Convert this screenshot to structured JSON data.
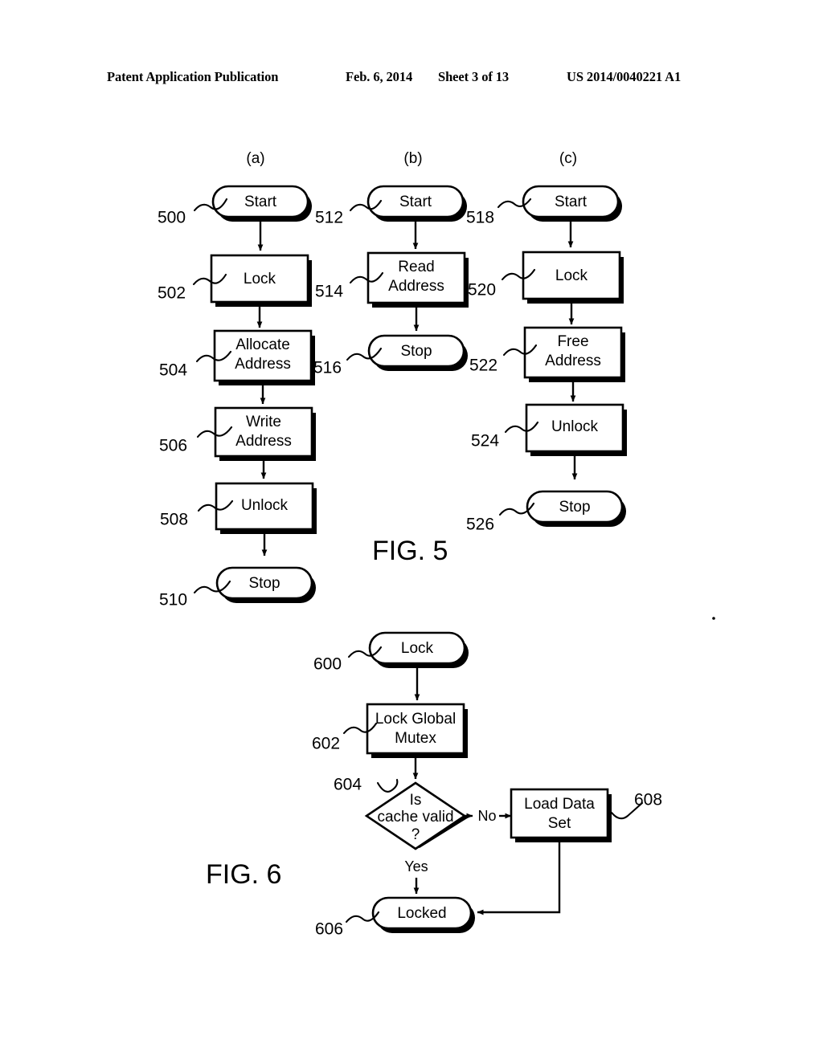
{
  "header": {
    "publication": "Patent Application Publication",
    "date": "Feb. 6, 2014",
    "sheet": "Sheet 3 of 13",
    "number": "US 2014/0040221 A1"
  },
  "figures": [
    {
      "label": "FIG. 5",
      "columns": [
        {
          "caption": "(a)",
          "nodes": [
            {
              "ref": "500",
              "text": "Start",
              "shape": "pill"
            },
            {
              "ref": "502",
              "text": "Lock",
              "shape": "box"
            },
            {
              "ref": "504",
              "text": "Allocate Address",
              "shape": "box"
            },
            {
              "ref": "506",
              "text": "Write Address",
              "shape": "box"
            },
            {
              "ref": "508",
              "text": "Unlock",
              "shape": "box"
            },
            {
              "ref": "510",
              "text": "Stop",
              "shape": "pill"
            }
          ]
        },
        {
          "caption": "(b)",
          "nodes": [
            {
              "ref": "512",
              "text": "Start",
              "shape": "pill"
            },
            {
              "ref": "514",
              "text": "Read Address",
              "shape": "box"
            },
            {
              "ref": "516",
              "text": "Stop",
              "shape": "pill"
            }
          ]
        },
        {
          "caption": "(c)",
          "nodes": [
            {
              "ref": "518",
              "text": "Start",
              "shape": "pill"
            },
            {
              "ref": "520",
              "text": "Lock",
              "shape": "box"
            },
            {
              "ref": "522",
              "text": "Free Address",
              "shape": "box"
            },
            {
              "ref": "524",
              "text": "Unlock",
              "shape": "box"
            },
            {
              "ref": "526",
              "text": "Stop",
              "shape": "pill"
            }
          ]
        }
      ]
    },
    {
      "label": "FIG. 6",
      "nodes": [
        {
          "ref": "600",
          "text": "Lock",
          "shape": "pill"
        },
        {
          "ref": "602",
          "text": "Lock Global Mutex",
          "shape": "box"
        },
        {
          "ref": "604",
          "text": "Is cache valid ?",
          "shape": "diamond"
        },
        {
          "ref": "606",
          "text": "Locked",
          "shape": "pill"
        },
        {
          "ref": "608",
          "text": "Load Data Set",
          "shape": "box"
        }
      ],
      "branches": [
        {
          "label": "No",
          "from": "604",
          "to": "608"
        },
        {
          "label": "Yes",
          "from": "604",
          "to": "606"
        }
      ]
    }
  ],
  "node_text": {
    "n500": "Start",
    "n502": "Lock",
    "n504_l1": "Allocate",
    "n504_l2": "Address",
    "n506_l1": "Write",
    "n506_l2": "Address",
    "n508": "Unlock",
    "n510": "Stop",
    "n512": "Start",
    "n514_l1": "Read",
    "n514_l2": "Address",
    "n516": "Stop",
    "n518": "Start",
    "n520": "Lock",
    "n522_l1": "Free",
    "n522_l2": "Address",
    "n524": "Unlock",
    "n526": "Stop",
    "n600": "Lock",
    "n602_l1": "Lock Global",
    "n602_l2": "Mutex",
    "n604_l1": "Is",
    "n604_l2": "cache valid",
    "n604_l3": "?",
    "n606": "Locked",
    "n608_l1": "Load Data",
    "n608_l2": "Set"
  },
  "ref_numbers": {
    "r500": "500",
    "r502": "502",
    "r504": "504",
    "r506": "506",
    "r508": "508",
    "r510": "510",
    "r512": "512",
    "r514": "514",
    "r516": "516",
    "r518": "518",
    "r520": "520",
    "r522": "522",
    "r524": "524",
    "r526": "526",
    "r600": "600",
    "r602": "602",
    "r604": "604",
    "r606": "606",
    "r608": "608"
  },
  "captions": {
    "col_a": "(a)",
    "col_b": "(b)",
    "col_c": "(c)",
    "fig5": "FIG. 5",
    "fig6": "FIG. 6"
  },
  "branch_labels": {
    "no": "No",
    "yes": "Yes"
  },
  "colors": {
    "ink": "#000000",
    "paper": "#ffffff"
  }
}
